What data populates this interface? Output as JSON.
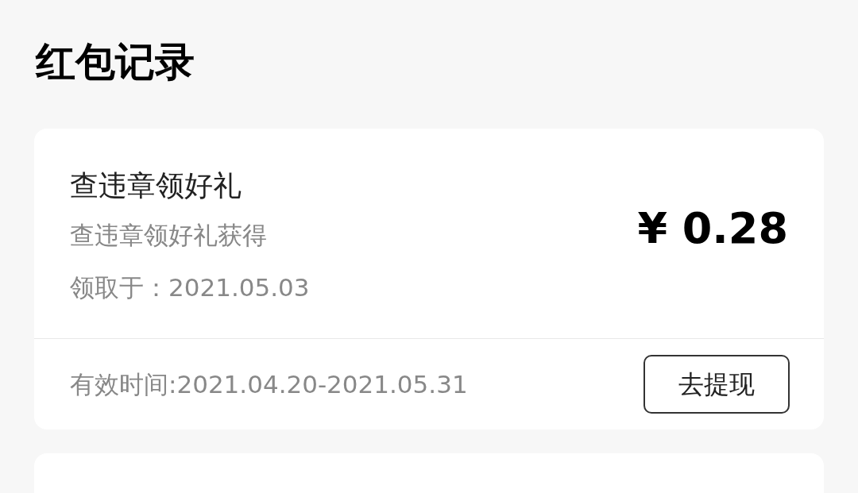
{
  "page_title": "红包记录",
  "records": [
    {
      "title": "查违章领好礼",
      "source": "查违章领好礼获得",
      "received": "领取于：2021.05.03",
      "amount": "¥ 0.28",
      "validity": "有效时间:2021.04.20-2021.05.31",
      "action": "去提现"
    }
  ]
}
